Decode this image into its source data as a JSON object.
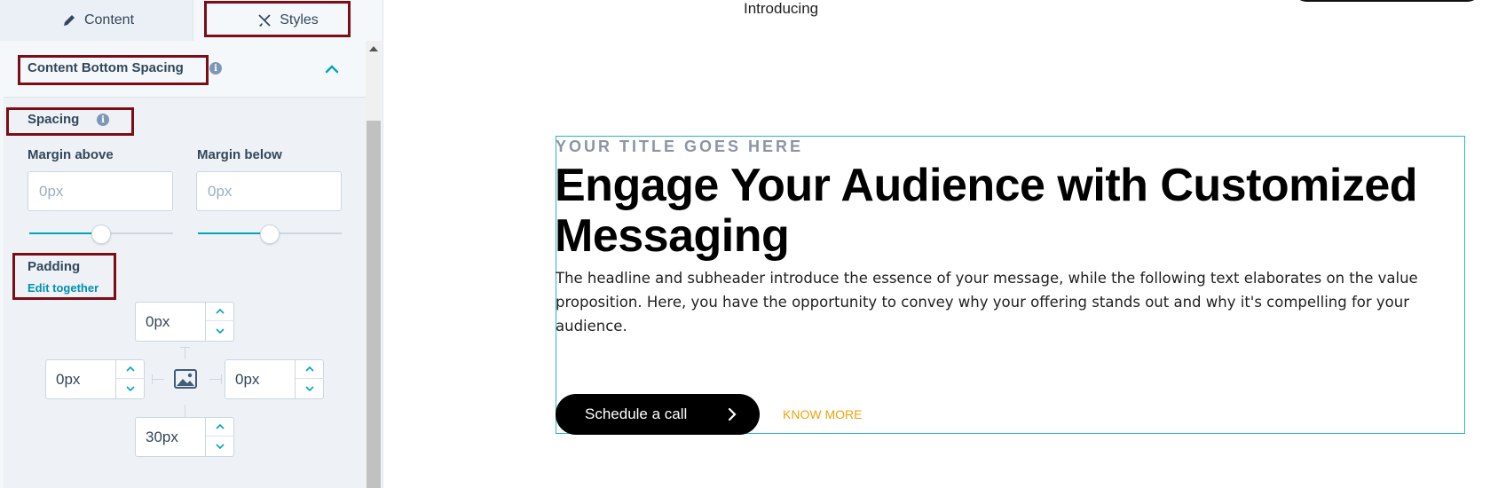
{
  "tabs": {
    "content_label": "Content",
    "styles_label": "Styles"
  },
  "section": {
    "title": "Content Bottom Spacing"
  },
  "spacing": {
    "label": "Spacing",
    "margin_above_label": "Margin above",
    "margin_above_placeholder": "0px",
    "margin_above_slider": 0.5,
    "margin_below_label": "Margin below",
    "margin_below_placeholder": "0px",
    "margin_below_slider": 0.5
  },
  "padding": {
    "label": "Padding",
    "edit_together_label": "Edit together",
    "top_value": "0px",
    "left_value": "0px",
    "right_value": "0px",
    "bottom_value": "30px"
  },
  "preview": {
    "top_text": "Introducing",
    "eyebrow": "YOUR TITLE GOES HERE",
    "headline": "Engage Your Audience with Customized Messaging",
    "body": "The headline and subheader introduce the essence of your message, while the following text elaborates on the value proposition. Here, you have the opportunity to convey why your offering stands out and why it's compelling for your audience.",
    "primary_button": "Schedule a call",
    "secondary_button": "KNOW MORE"
  },
  "colors": {
    "accent": "#00a4bd",
    "highlight": "#7b0d17",
    "cta_secondary": "#f0a30a"
  },
  "icons": {
    "content_tab": "pencil-icon",
    "styles_tab": "brush-icon",
    "info": "info-icon",
    "collapse": "chevron-up-icon",
    "image": "image-icon",
    "cta_arrow": "chevron-right-icon"
  }
}
